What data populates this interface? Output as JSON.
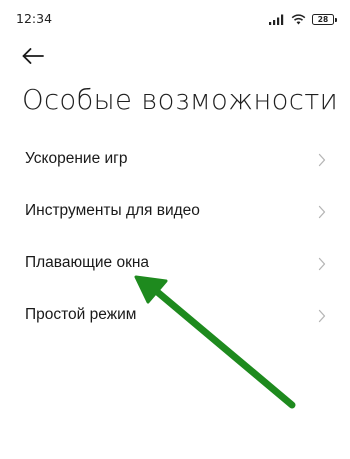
{
  "status_bar": {
    "time": "12:34",
    "battery_level": "28",
    "icons": [
      "signal-icon",
      "wifi-icon",
      "battery-icon"
    ]
  },
  "header": {
    "back_icon": "back-arrow-icon",
    "title": "Особые возможности"
  },
  "settings": {
    "items": [
      {
        "label": "Ускорение игр"
      },
      {
        "label": "Инструменты для видео"
      },
      {
        "label": "Плавающие окна"
      },
      {
        "label": "Простой режим"
      }
    ],
    "chevron_icon": "chevron-right-icon"
  },
  "annotation": {
    "type": "arrow",
    "color": "#1e8a1e",
    "points_to": "Плавающие окна"
  }
}
